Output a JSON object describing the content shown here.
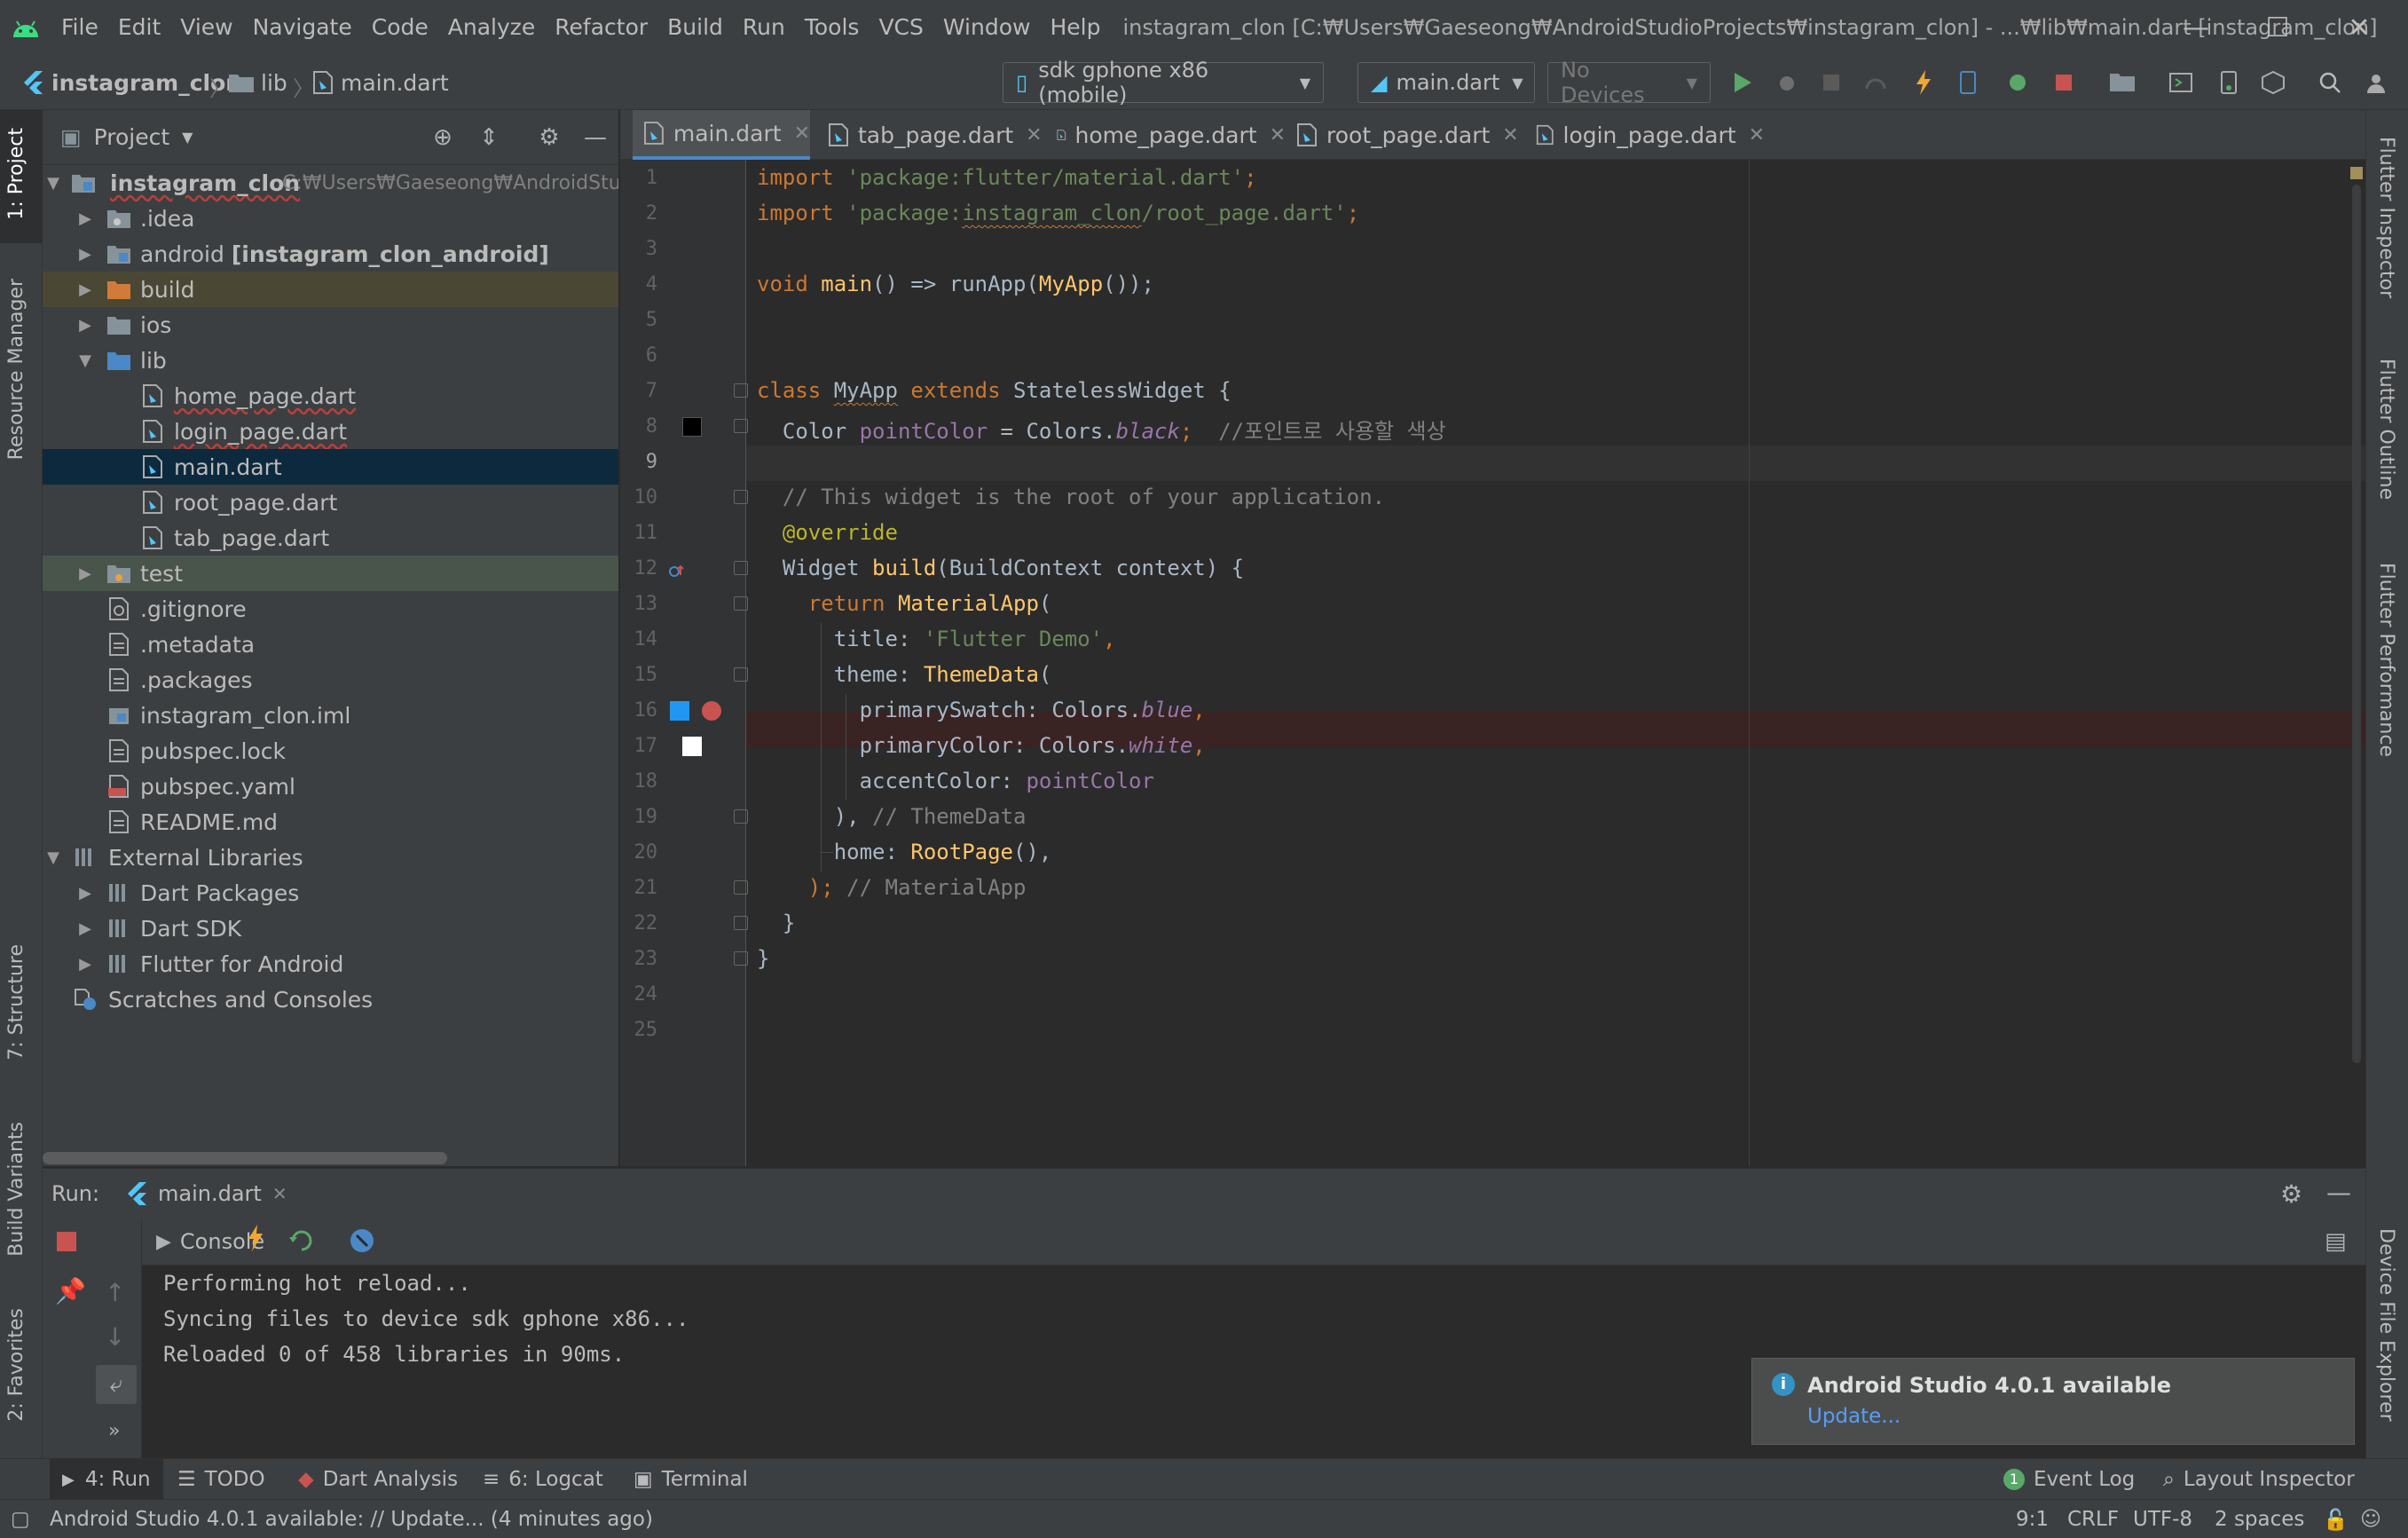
{
  "window": {
    "title": "instagram_clon [C:₩Users₩Gaeseong₩AndroidStudioProjects₩instagram_clon] - ...₩lib₩main.dart [instagram_clon]",
    "minimize": "—",
    "maximize": "☐",
    "close": "✕"
  },
  "menu": [
    "File",
    "Edit",
    "View",
    "Navigate",
    "Code",
    "Analyze",
    "Refactor",
    "Build",
    "Run",
    "Tools",
    "VCS",
    "Window",
    "Help"
  ],
  "navbar": {
    "breadcrumbs": [
      "instagram_clon",
      "lib",
      "main.dart"
    ],
    "device_combo": "sdk gphone x86 (mobile)",
    "config_combo": "main.dart",
    "no_devices": "No Devices"
  },
  "left_tabs": {
    "project": "1: Project",
    "resource_manager": "Resource Manager",
    "structure": "7: Structure",
    "build_variants": "Build Variants",
    "favorites": "2: Favorites"
  },
  "right_tabs": {
    "flutter_inspector": "Flutter Inspector",
    "flutter_outline": "Flutter Outline",
    "flutter_performance": "Flutter Performance",
    "device_file_explorer": "Device File Explorer"
  },
  "project_panel": {
    "title": "Project",
    "tree": [
      {
        "label": "instagram_clon",
        "hint": "C:₩Users₩Gaeseong₩AndroidStudio"
      },
      {
        "label": ".idea"
      },
      {
        "label": "android",
        "suffix": "[instagram_clon_android]"
      },
      {
        "label": "build"
      },
      {
        "label": "ios"
      },
      {
        "label": "lib"
      },
      {
        "label": "home_page.dart"
      },
      {
        "label": "login_page.dart"
      },
      {
        "label": "main.dart"
      },
      {
        "label": "root_page.dart"
      },
      {
        "label": "tab_page.dart"
      },
      {
        "label": "test"
      },
      {
        "label": ".gitignore"
      },
      {
        "label": ".metadata"
      },
      {
        "label": ".packages"
      },
      {
        "label": "instagram_clon.iml"
      },
      {
        "label": "pubspec.lock"
      },
      {
        "label": "pubspec.yaml"
      },
      {
        "label": "README.md"
      },
      {
        "label": "External Libraries"
      },
      {
        "label": "Dart Packages"
      },
      {
        "label": "Dart SDK"
      },
      {
        "label": "Flutter for Android"
      },
      {
        "label": "Scratches and Consoles"
      }
    ]
  },
  "editor_tabs": [
    "main.dart",
    "tab_page.dart",
    "home_page.dart",
    "root_page.dart",
    "login_page.dart"
  ],
  "editor": {
    "line_numbers": [
      "1",
      "2",
      "3",
      "4",
      "5",
      "6",
      "7",
      "8",
      "9",
      "10",
      "11",
      "12",
      "13",
      "14",
      "15",
      "16",
      "17",
      "18",
      "19",
      "20",
      "21",
      "22",
      "23",
      "24",
      "25"
    ],
    "code": {
      "l1a": "import ",
      "l1b": "'package:flutter/material.dart'",
      "l1c": ";",
      "l2a": "import ",
      "l2b1": "'package:",
      "l2b2": "instagram_clon",
      "l2b3": "/root_page.dart'",
      "l2c": ";",
      "l4a": "void ",
      "l4b": "main",
      "l4c": "() => runApp(",
      "l4d": "MyApp",
      "l4e": "());",
      "l7a": "class ",
      "l7b": "MyApp",
      "l7c": " extends ",
      "l7d": "StatelessWidget {",
      "l8a": "  Color ",
      "l8b": "pointColor",
      "l8c": " = Colors.",
      "l8d": "black",
      "l8e": ";  ",
      "l8f": "//포인트로 사용할 색상",
      "l10": "  // This widget is the root of your application.",
      "l11": "  @override",
      "l12a": "  Widget ",
      "l12b": "build",
      "l12c": "(BuildContext context) {",
      "l13a": "    return ",
      "l13b": "MaterialApp",
      "l13c": "(",
      "l14a": "      title: ",
      "l14b": "'Flutter Demo'",
      "l14c": ",",
      "l15a": "      theme: ",
      "l15b": "ThemeData",
      "l15c": "(",
      "l16a": "        primarySwatch: Colors.",
      "l16b": "blue",
      "l16c": ",",
      "l17a": "        primaryColor: Colors.",
      "l17b": "white",
      "l17c": ",",
      "l18a": "        accentColor: ",
      "l18b": "pointColor",
      "l19a": "      ), ",
      "l19b": "// ThemeData",
      "l20a": "      home: ",
      "l20b": "RootPage",
      "l20c": "(),",
      "l21a": "    ); ",
      "l21b": "// MaterialApp",
      "l22": "  }",
      "l23": "}"
    }
  },
  "run_panel": {
    "label": "Run:",
    "tab": "main.dart",
    "console_tab": "Console",
    "output": [
      "Performing hot reload...",
      "Syncing files to device sdk gphone x86...",
      "Reloaded 0 of 458 libraries in 90ms."
    ]
  },
  "notification": {
    "title": "Android Studio 4.0.1 available",
    "link": "Update..."
  },
  "bottom_tabs": {
    "run": "4: Run",
    "todo": "TODO",
    "dart_analysis": "Dart Analysis",
    "logcat": "6: Logcat",
    "terminal": "Terminal",
    "event_log": "Event Log",
    "event_log_count": "1",
    "layout_inspector": "Layout Inspector"
  },
  "status_bar": {
    "message": "Android Studio 4.0.1 available: // Update... (4 minutes ago)",
    "position": "9:1",
    "line_sep": "CRLF",
    "encoding": "UTF-8",
    "indent": "2 spaces"
  },
  "colors": {
    "flutter_blue": "#54c5f8",
    "run_green": "#59a869",
    "stop_red": "#c75450",
    "selection": "#0d293e",
    "breakpoint_line": "#3a2323"
  }
}
